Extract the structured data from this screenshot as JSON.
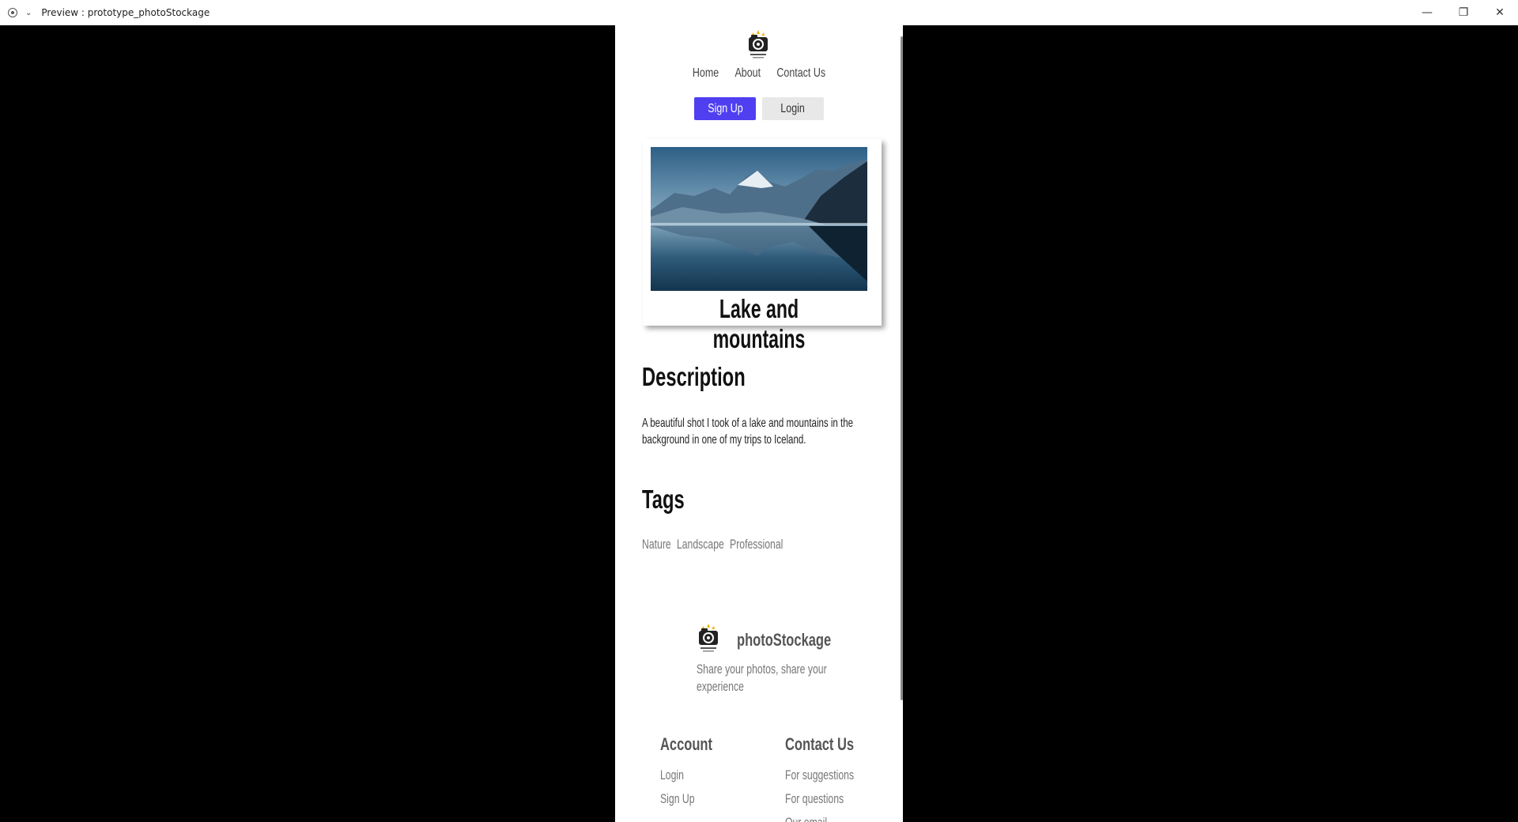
{
  "window": {
    "title": "Preview : prototype_photoStockage",
    "minimize_glyph": "—",
    "restore_glyph": "❐",
    "close_glyph": "✕",
    "chevron_glyph": "⌄"
  },
  "header": {
    "nav": [
      "Home",
      "About",
      "Contact Us"
    ],
    "signup_label": "Sign Up",
    "login_label": "Login"
  },
  "photo_card": {
    "title": "Lake and mountains"
  },
  "description": {
    "heading": "Description",
    "text": "A beautiful shot I took of a lake and mountains in the background in one of my trips to Iceland."
  },
  "tags": {
    "heading": "Tags",
    "items": [
      "Nature",
      "Landscape",
      "Professional"
    ]
  },
  "footer": {
    "brand": "photoStockage",
    "tagline": "Share your photos, share your experience",
    "account": {
      "heading": "Account",
      "links": [
        "Login",
        "Sign Up"
      ]
    },
    "contact": {
      "heading": "Contact Us",
      "links": [
        "For suggestions",
        "For questions",
        "Our email"
      ]
    }
  },
  "colors": {
    "accent": "#4f3ff0",
    "background": "#000000"
  },
  "icons": [
    "app-icon",
    "chevron-down-icon",
    "minimize-icon",
    "restore-icon",
    "close-icon",
    "camera-logo-icon"
  ]
}
